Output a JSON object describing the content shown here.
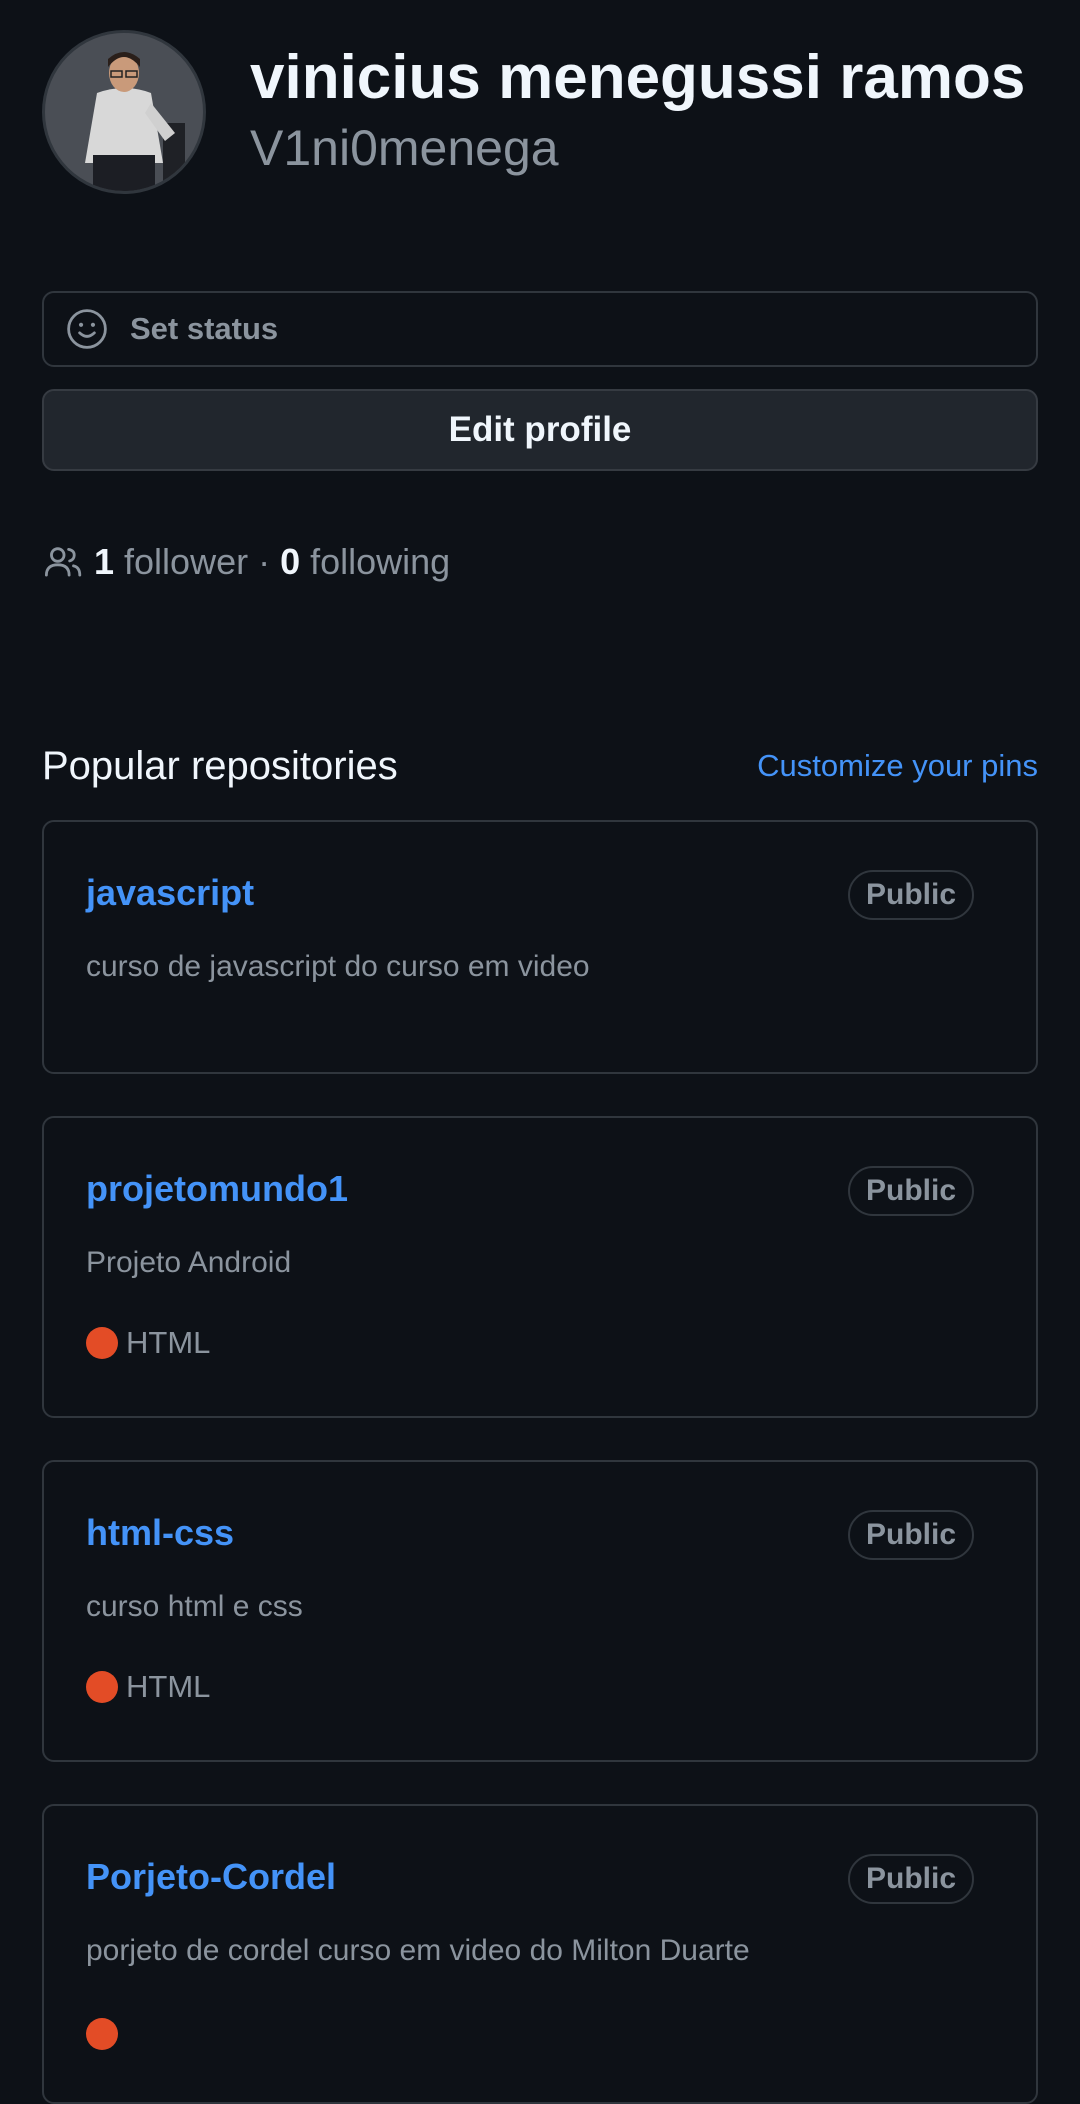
{
  "profile": {
    "full_name": "vinicius menegussi ramos",
    "login": "V1ni0menega"
  },
  "status": {
    "label": "Set status",
    "icon": "smiley-icon"
  },
  "edit_profile": {
    "label": "Edit profile"
  },
  "follow": {
    "icon": "people-icon",
    "followers_count": "1",
    "followers_label": " follower · ",
    "following_count": "0",
    "following_label": " following"
  },
  "popular": {
    "title": "Popular repositories",
    "customize_label": "Customize your pins",
    "repos": [
      {
        "name": "javascript",
        "badge": "Public",
        "description": "curso de javascript do curso em video"
      },
      {
        "name": "projetomundo1",
        "badge": "Public",
        "description": "Projeto Android",
        "language": "HTML"
      },
      {
        "name": "html-css",
        "badge": "Public",
        "description": "curso html e css",
        "language": "HTML"
      },
      {
        "name": "Porjeto-Cordel",
        "badge": "Public",
        "description": "porjeto de cordel curso em video do Milton Duarte"
      }
    ]
  },
  "colors": {
    "background": "#0d1117",
    "link": "#4493f8",
    "muted": "#8b949e",
    "html_language": "#e34c26"
  }
}
